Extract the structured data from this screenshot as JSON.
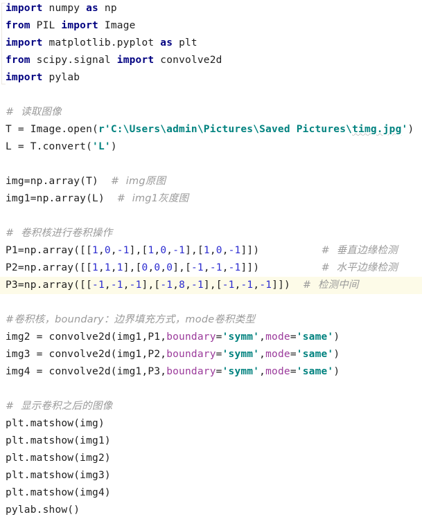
{
  "editor": {
    "background_color": "#ffffff",
    "current_line_highlight_color": "#fdfbe8",
    "colors": {
      "keyword": "#000080",
      "string": "#00827f",
      "number": "#2b2bd0",
      "keyword_argument": "#9b3a9b",
      "comment": "#9a9a9a",
      "plain_text": "#202020"
    }
  },
  "code_lines": [
    {
      "id": 1,
      "text": "import numpy as np"
    },
    {
      "id": 2,
      "text": "from PIL import Image"
    },
    {
      "id": 3,
      "text": "import matplotlib.pyplot as plt"
    },
    {
      "id": 4,
      "text": "from scipy.signal import convolve2d"
    },
    {
      "id": 5,
      "text": "import pylab"
    },
    {
      "id": 6,
      "text": ""
    },
    {
      "id": 7,
      "text": "# 读取图像"
    },
    {
      "id": 8,
      "text": "T = Image.open(r'C:\\Users\\admin\\Pictures\\Saved Pictures\\timg.jpg')"
    },
    {
      "id": 9,
      "text": "L = T.convert('L')"
    },
    {
      "id": 10,
      "text": ""
    },
    {
      "id": 11,
      "text": "img=np.array(T)  # img原图"
    },
    {
      "id": 12,
      "text": "img1=np.array(L)  # img1灰度图"
    },
    {
      "id": 13,
      "text": ""
    },
    {
      "id": 14,
      "text": "# 卷积核进行卷积操作"
    },
    {
      "id": 15,
      "text": "P1=np.array([[1,0,-1],[1,0,-1],[1,0,-1]])          # 垂直边缘检测"
    },
    {
      "id": 16,
      "text": "P2=np.array([[1,1,1],[0,0,0],[-1,-1,-1]])          # 水平边缘检测"
    },
    {
      "id": 17,
      "text": "P3=np.array([[-1,-1,-1],[-1,8,-1],[-1,-1,-1]])  # 检测中间"
    },
    {
      "id": 18,
      "text": ""
    },
    {
      "id": 19,
      "text": "#卷积核，boundary：边界填充方式，mode卷积类型"
    },
    {
      "id": 20,
      "text": "img2 = convolve2d(img1,P1,boundary='symm',mode='same')"
    },
    {
      "id": 21,
      "text": "img3 = convolve2d(img1,P2,boundary='symm',mode='same')"
    },
    {
      "id": 22,
      "text": "img4 = convolve2d(img1,P3,boundary='symm',mode='same')"
    },
    {
      "id": 23,
      "text": ""
    },
    {
      "id": 24,
      "text": "# 显示卷积之后的图像"
    },
    {
      "id": 25,
      "text": "plt.matshow(img)"
    },
    {
      "id": 26,
      "text": "plt.matshow(img1)"
    },
    {
      "id": 27,
      "text": "plt.matshow(img2)"
    },
    {
      "id": 28,
      "text": "plt.matshow(img3)"
    },
    {
      "id": 29,
      "text": "plt.matshow(img4)"
    },
    {
      "id": 30,
      "text": "pylab.show()"
    }
  ],
  "tokens": {
    "l1": {
      "kw": "import",
      "rest": " numpy ",
      "kw2": "as",
      "rest2": " np"
    },
    "l2": {
      "kw": "from",
      "mid": " PIL ",
      "kw2": "import",
      "rest": " Image"
    },
    "l3": {
      "kw": "import",
      "mid": " matplotlib.pyplot ",
      "kw2": "as",
      "rest": " plt"
    },
    "l4": {
      "kw": "from",
      "mid": " scipy.signal ",
      "kw2": "import",
      "rest": " convolve2d"
    },
    "l5": {
      "kw": "import",
      "rest": " pylab"
    },
    "l7": {
      "comment": "#  读取图像"
    },
    "l8": {
      "pre": "T = Image.open(",
      "str": "r'C:\\Users\\admin\\Pictures\\Saved Pictures\\",
      "str_squiggle": "timg.jpg",
      "str_end": "'",
      "post": ")"
    },
    "l9": {
      "pre": "L = T.convert(",
      "str": "'L'",
      "post": ")"
    },
    "l11": {
      "code": "img=np.array(T)",
      "gap": "  ",
      "comment": "#  img原图"
    },
    "l12": {
      "code": "img1=np.array(L)",
      "gap": "  ",
      "comment": "#  img1灰度图"
    },
    "l14": {
      "comment": "#  卷积核进行卷积操作"
    },
    "l15": {
      "pre": "P1=np.array([[",
      "n1": "1",
      "c1": ",",
      "n2": "0",
      "c2": ",",
      "n3": "-1",
      "mid": "],[",
      "comment": "#  垂直边缘检测"
    },
    "l16": {
      "pre": "P2=np.array([[",
      "comment": "#  水平边缘检测"
    },
    "l17": {
      "pre": "P3=np.array([[",
      "comment": "#  检测中间"
    },
    "l19": {
      "comment": "#卷积核，boundary：边界填充方式，mode卷积类型"
    },
    "l20": {
      "pre": "img2 = convolve2d(img1,P1,",
      "kwarg1": "boundary",
      "eq1": "=",
      "str1": "'symm'",
      "comma": ",",
      "kwarg2": "mode",
      "eq2": "=",
      "str2": "'same'",
      "post": ")"
    },
    "l21": {
      "pre": "img3 = convolve2d(img1,P2,",
      "kwarg1": "boundary",
      "eq1": "=",
      "str1": "'symm'",
      "comma": ",",
      "kwarg2": "mode",
      "eq2": "=",
      "str2": "'same'",
      "post": ")"
    },
    "l22": {
      "pre": "img4 = convolve2d(img1,P3,",
      "kwarg1": "boundary",
      "eq1": "=",
      "str1": "'symm'",
      "comma": ",",
      "kwarg2": "mode",
      "eq2": "=",
      "str2": "'same'",
      "post": ")"
    },
    "l24": {
      "comment": "#  显示卷积之后的图像"
    },
    "l25": {
      "code": "plt.matshow(img)"
    },
    "l26": {
      "code": "plt.matshow(img1)"
    },
    "l27": {
      "code": "plt.matshow(img2)"
    },
    "l28": {
      "code": "plt.matshow(img3)"
    },
    "l29": {
      "code": "plt.matshow(img4)"
    },
    "l30": {
      "code": "pylab.show()"
    }
  },
  "array_values": {
    "P1": [
      [
        1,
        0,
        -1
      ],
      [
        1,
        0,
        -1
      ],
      [
        1,
        0,
        -1
      ]
    ],
    "P2": [
      [
        1,
        1,
        1
      ],
      [
        0,
        0,
        0
      ],
      [
        -1,
        -1,
        -1
      ]
    ],
    "P3": [
      [
        -1,
        -1,
        -1
      ],
      [
        -1,
        8,
        -1
      ],
      [
        -1,
        -1,
        -1
      ]
    ]
  },
  "current_line_number": 17
}
